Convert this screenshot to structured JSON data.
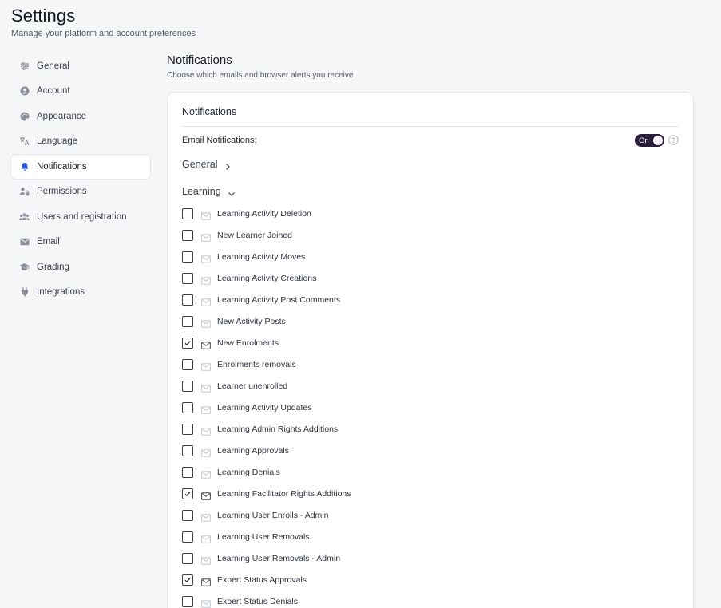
{
  "header": {
    "title": "Settings",
    "subtitle": "Manage your platform and account preferences"
  },
  "sidebar": {
    "items": [
      {
        "label": "General",
        "icon": "sliders-icon",
        "active": false
      },
      {
        "label": "Account",
        "icon": "user-circle-icon",
        "active": false
      },
      {
        "label": "Appearance",
        "icon": "palette-icon",
        "active": false
      },
      {
        "label": "Language",
        "icon": "translate-icon",
        "active": false
      },
      {
        "label": "Notifications",
        "icon": "bell-icon",
        "active": true
      },
      {
        "label": "Permissions",
        "icon": "user-lock-icon",
        "active": false
      },
      {
        "label": "Users and registration",
        "icon": "users-icon",
        "active": false
      },
      {
        "label": "Email",
        "icon": "envelope-icon",
        "active": false
      },
      {
        "label": "Grading",
        "icon": "graduation-cap-icon",
        "active": false
      },
      {
        "label": "Integrations",
        "icon": "plug-icon",
        "active": false
      }
    ]
  },
  "section": {
    "title": "Notifications",
    "subtitle": "Choose which emails and browser alerts you receive"
  },
  "card": {
    "title": "Notifications",
    "email_notifications_label": "Email Notifications:",
    "email_toggle_label": "On",
    "email_toggle_state": true,
    "groups": {
      "general": {
        "label": "General",
        "expanded": false
      },
      "learning": {
        "label": "Learning",
        "expanded": true
      }
    },
    "learning_items": [
      {
        "label": "Learning Activity Deletion",
        "checked": false
      },
      {
        "label": "New Learner Joined",
        "checked": false
      },
      {
        "label": "Learning Activity Moves",
        "checked": false
      },
      {
        "label": "Learning Activity Creations",
        "checked": false
      },
      {
        "label": "Learning Activity Post Comments",
        "checked": false
      },
      {
        "label": "New Activity Posts",
        "checked": false
      },
      {
        "label": "New Enrolments",
        "checked": true
      },
      {
        "label": "Enrolments removals",
        "checked": false
      },
      {
        "label": "Learner unenrolled",
        "checked": false
      },
      {
        "label": "Learning Activity Updates",
        "checked": false
      },
      {
        "label": "Learning Admin Rights Additions",
        "checked": false
      },
      {
        "label": "Learning Approvals",
        "checked": false
      },
      {
        "label": "Learning Denials",
        "checked": false
      },
      {
        "label": "Learning Facilitator Rights Additions",
        "checked": true
      },
      {
        "label": "Learning User Enrolls - Admin",
        "checked": false
      },
      {
        "label": "Learning User Removals",
        "checked": false
      },
      {
        "label": "Learning User Removals - Admin",
        "checked": false
      },
      {
        "label": "Expert Status Approvals",
        "checked": true
      },
      {
        "label": "Expert Status Denials",
        "checked": false
      }
    ]
  },
  "colors": {
    "accent": "#2455d8",
    "toggle_bg": "#2b1d3d",
    "page_bg": "#f5f6f8"
  }
}
